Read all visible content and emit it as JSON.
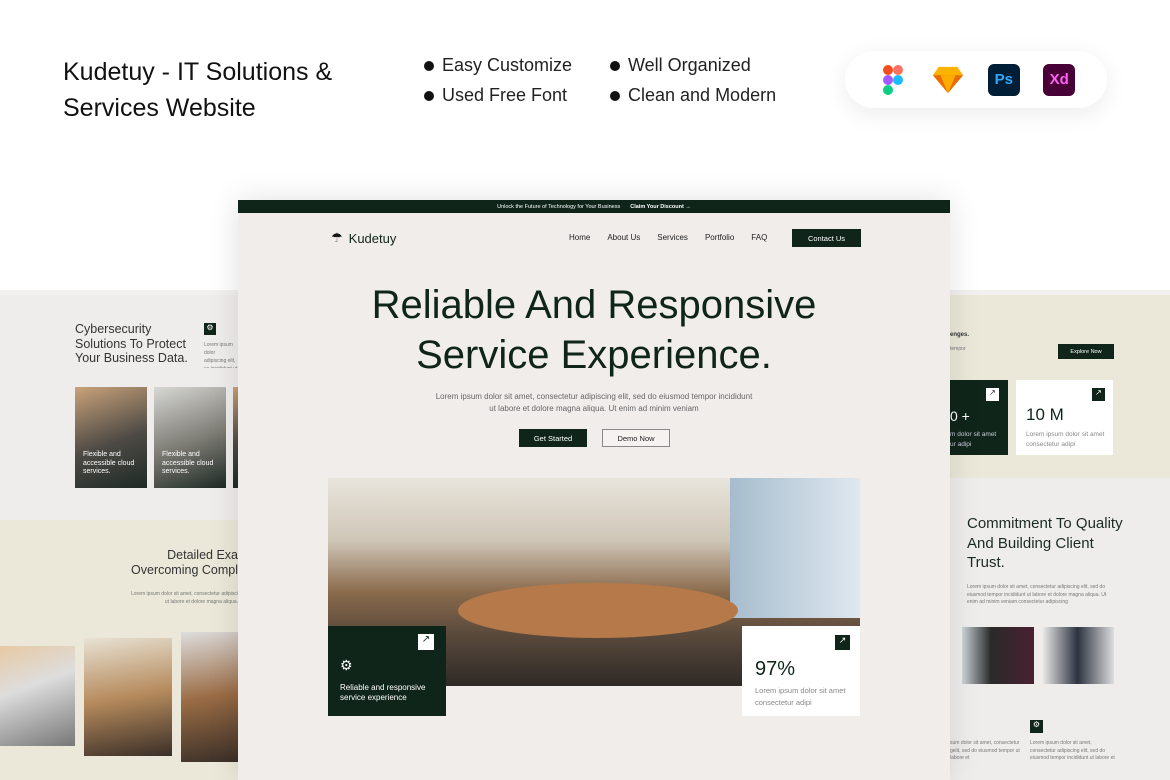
{
  "header": {
    "title": "Kudetuy - IT Solutions & Services Website",
    "features": [
      "Easy Customize",
      "Well Organized",
      "Used Free Font",
      "Clean and Modern"
    ],
    "tools": [
      {
        "name": "figma-icon",
        "label": ""
      },
      {
        "name": "sketch-icon",
        "label": ""
      },
      {
        "name": "photoshop-icon",
        "label": "Ps"
      },
      {
        "name": "xd-icon",
        "label": "Xd"
      }
    ]
  },
  "mockup": {
    "topbar": {
      "text": "Unlock the Future of Technology for Your Business",
      "link": "Claim Your Discount →"
    },
    "brand": "Kudetuy",
    "nav": [
      "Home",
      "About Us",
      "Services",
      "Portfolio",
      "FAQ"
    ],
    "contact": "Contact Us",
    "hero_line1": "Reliable And Responsive",
    "hero_line2": "Service Experience.",
    "para1": "Lorem ipsum dolor sit amet, consectetur adipiscing elit, sed do eiusmod tempor incididunt",
    "para2": "ut labore et dolore magna aliqua. Ut enim ad minim veniam",
    "get_started": "Get Started",
    "demo": "Demo Now",
    "card_text": "Reliable and responsive service experience",
    "stat_value": "97%",
    "stat_text": "Lorem ipsum dolor sit amet consectetur adipi"
  },
  "left": {
    "heading": "Cybersecurity Solutions To Protect Your Business Data.",
    "lorem": "Lorem ipsum dolor adipiscing elit, se incididunt ut labo",
    "card": "Flexible and accessible cloud services.",
    "heading2a": "Detailed Exa",
    "heading2b": "Overcoming Compl",
    "lorem2": "Lorem ipsum dolor sit amet, consectetur adipisci ut labore et dolore magna aliqua."
  },
  "right": {
    "frag": "enges.",
    "frag2": "tempor",
    "explore": "Explore Now",
    "stat1": "0 +",
    "stat1_text": "m dolor sit amet ur adipi",
    "stat2": "10 M",
    "stat2_text": "Lorem ipsum dolor sit amet consectetur adipi",
    "heading": "Commitment To Quality And Building Client Trust.",
    "lorem": "Lorem ipsum dolor sit amet, consectetur adipiscing elit, sed do eiusmod tempor incididunt ut labore et dolore magna aliqua. Ut enim ad minim veniam consectetur adipiscing",
    "lorem3": "Lorem ipsum dolor sit amet, consectetur adipiscing elit, sed do eiusmod tempor incididunt ut labore et",
    "lorem4": "sum dolor sit amet, consectetur gelit, sed do eiusmod tempor ut labore et"
  },
  "colors": {
    "primary": "#10251a",
    "bg": "#f1edeb",
    "beige": "#ebe8d9"
  }
}
